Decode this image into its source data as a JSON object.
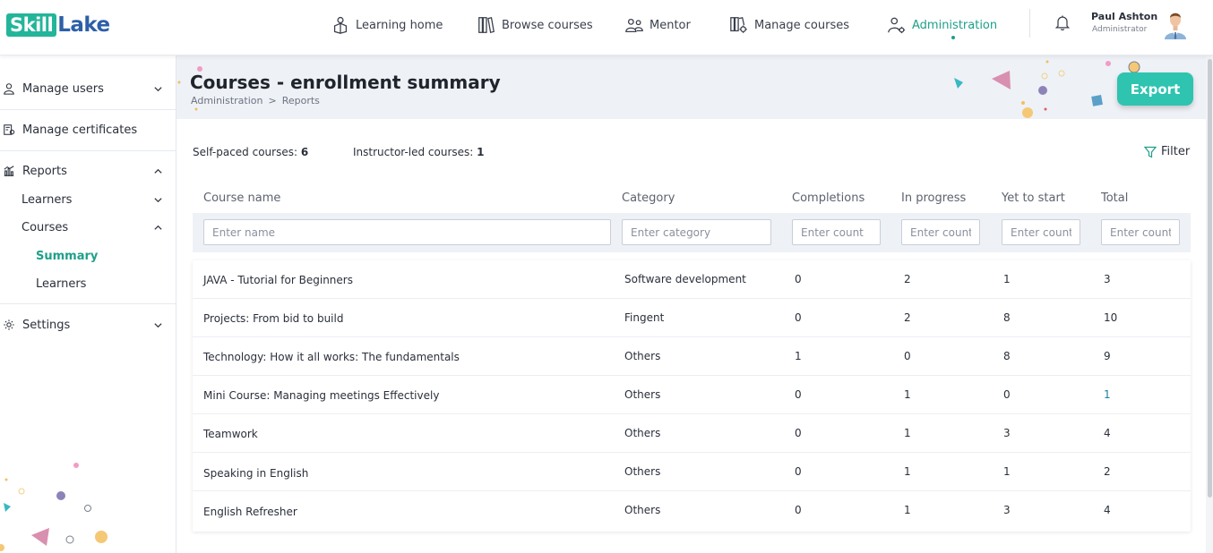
{
  "brand": {
    "logo_part1": "Skill",
    "logo_part2": "Lake"
  },
  "nav": {
    "items": [
      {
        "label": "Learning home",
        "icon": "learning-home-icon"
      },
      {
        "label": "Browse courses",
        "icon": "browse-courses-icon"
      },
      {
        "label": "Mentor",
        "icon": "mentor-icon"
      },
      {
        "label": "Manage courses",
        "icon": "manage-courses-icon"
      },
      {
        "label": "Administration",
        "icon": "administration-icon",
        "active": true
      }
    ]
  },
  "user": {
    "name": "Paul Ashton",
    "role": "Administrator"
  },
  "sidebar": {
    "manage_users": "Manage users",
    "manage_certificates": "Manage certificates",
    "reports": "Reports",
    "learners": "Learners",
    "courses": "Courses",
    "summary": "Summary",
    "courses_learners": "Learners",
    "settings": "Settings"
  },
  "page": {
    "title": "Courses - enrollment summary",
    "breadcrumb": [
      "Administration",
      ">",
      "Reports"
    ],
    "export_label": "Export"
  },
  "stats": {
    "self_paced_label": "Self-paced courses:",
    "self_paced_value": "6",
    "instructor_led_label": "Instructor-led courses:",
    "instructor_led_value": "1",
    "filter_label": "Filter"
  },
  "table": {
    "headers": [
      "Course name",
      "Category",
      "Completions",
      "In progress",
      "Yet to start",
      "Total"
    ],
    "placeholders": [
      "Enter name",
      "Enter category",
      "Enter count",
      "Enter count",
      "Enter count",
      "Enter count"
    ],
    "rows": [
      [
        "JAVA - Tutorial for Beginners",
        "Software development",
        "0",
        "2",
        "1",
        "3"
      ],
      [
        "Projects: From bid to build",
        "Fingent",
        "0",
        "2",
        "8",
        "10"
      ],
      [
        "Technology: How it all works: The fundamentals",
        "Others",
        "1",
        "0",
        "8",
        "9"
      ],
      [
        "Mini Course: Managing meetings Effectively",
        "Others",
        "0",
        "1",
        "0",
        "1"
      ],
      [
        "Teamwork",
        "Others",
        "0",
        "1",
        "3",
        "4"
      ],
      [
        "Speaking in English",
        "Others",
        "0",
        "1",
        "1",
        "2"
      ],
      [
        "English Refresher",
        "Others",
        "0",
        "1",
        "3",
        "4"
      ]
    ]
  },
  "colors": {
    "accent": "#1e9f8a",
    "export": "#2ec4b0",
    "brand_blue": "#2d5fa8"
  }
}
